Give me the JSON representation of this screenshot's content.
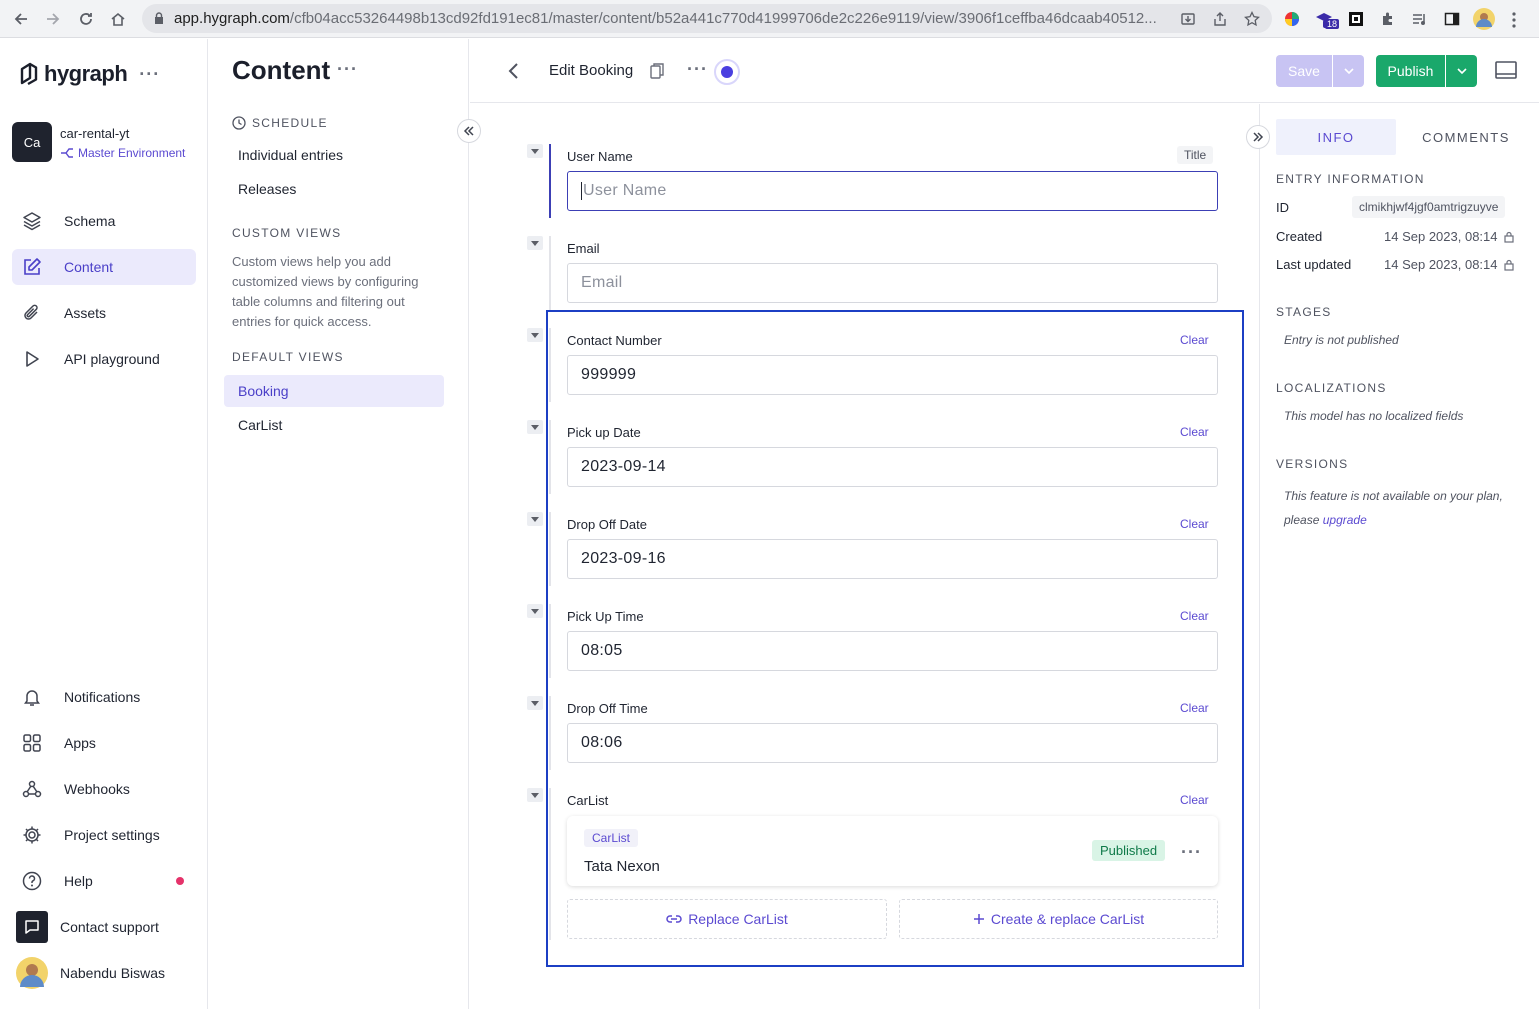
{
  "browser": {
    "url_host": "app.hygraph.com",
    "url_path": "/cfb04acc53264498b13cd92fd191ec81/master/content/b52a441c770d41999706de2c226e9119/view/3906f1ceffba46dcaab40512...",
    "extension_badge": "18"
  },
  "sidebar": {
    "logo_text": "hygraph",
    "project": {
      "avatar": "Ca",
      "name": "car-rental-yt",
      "environment": "Master Environment"
    },
    "nav": [
      {
        "label": "Schema",
        "icon": "layers-icon"
      },
      {
        "label": "Content",
        "icon": "edit-icon",
        "active": true
      },
      {
        "label": "Assets",
        "icon": "paperclip-icon"
      },
      {
        "label": "API playground",
        "icon": "play-icon"
      }
    ],
    "bottom_nav": [
      {
        "label": "Notifications",
        "icon": "bell-icon"
      },
      {
        "label": "Apps",
        "icon": "apps-icon"
      },
      {
        "label": "Webhooks",
        "icon": "webhook-icon"
      },
      {
        "label": "Project settings",
        "icon": "gear-icon"
      },
      {
        "label": "Help",
        "icon": "help-icon"
      },
      {
        "label": "Contact support",
        "icon": "chat-icon"
      },
      {
        "label": "Nabendu Biswas",
        "icon": "avatar"
      }
    ]
  },
  "content_panel": {
    "title": "Content",
    "schedule_heading": "SCHEDULE",
    "schedule_links": [
      "Individual entries",
      "Releases"
    ],
    "custom_views_heading": "CUSTOM VIEWS",
    "custom_views_desc": "Custom views help you add customized views by configuring table columns and filtering out entries for quick access.",
    "default_views_heading": "DEFAULT VIEWS",
    "default_views": [
      "Booking",
      "CarList"
    ]
  },
  "editor": {
    "title": "Edit Booking",
    "save_label": "Save",
    "publish_label": "Publish",
    "fields": [
      {
        "label": "User Name",
        "tag": "Title",
        "value": "",
        "placeholder": "User Name"
      },
      {
        "label": "Email",
        "value": "",
        "placeholder": "Email"
      },
      {
        "label": "Contact Number",
        "clear": "Clear",
        "value": "999999"
      },
      {
        "label": "Pick up Date",
        "clear": "Clear",
        "value": "2023-09-14"
      },
      {
        "label": "Drop Off Date",
        "clear": "Clear",
        "value": "2023-09-16"
      },
      {
        "label": "Pick Up Time",
        "clear": "Clear",
        "value": "08:05"
      },
      {
        "label": "Drop Off Time",
        "clear": "Clear",
        "value": "08:06"
      }
    ],
    "carlist": {
      "label": "CarList",
      "clear": "Clear",
      "card_type": "CarList",
      "card_title": "Tata Nexon",
      "card_status": "Published",
      "replace_label": "Replace CarList",
      "create_replace_label": "Create & replace CarList"
    }
  },
  "right_panel": {
    "tabs": [
      "INFO",
      "COMMENTS"
    ],
    "entry_info_heading": "ENTRY INFORMATION",
    "id_label": "ID",
    "id_value": "clmikhjwf4jgf0amtrigzuyve",
    "created_label": "Created",
    "created_value": "14 Sep 2023, 08:14",
    "updated_label": "Last updated",
    "updated_value": "14 Sep 2023, 08:14",
    "stages_heading": "STAGES",
    "stages_text": "Entry is not published",
    "localizations_heading": "LOCALIZATIONS",
    "localizations_text": "This model has no localized fields",
    "versions_heading": "VERSIONS",
    "versions_text": "This feature is not available on your plan, please",
    "versions_link": "upgrade"
  },
  "colors": {
    "accent": "#5b4ad1",
    "publish": "#1aa86b",
    "save_disabled": "#c8c4f3",
    "highlight": "#1c3fc4"
  }
}
